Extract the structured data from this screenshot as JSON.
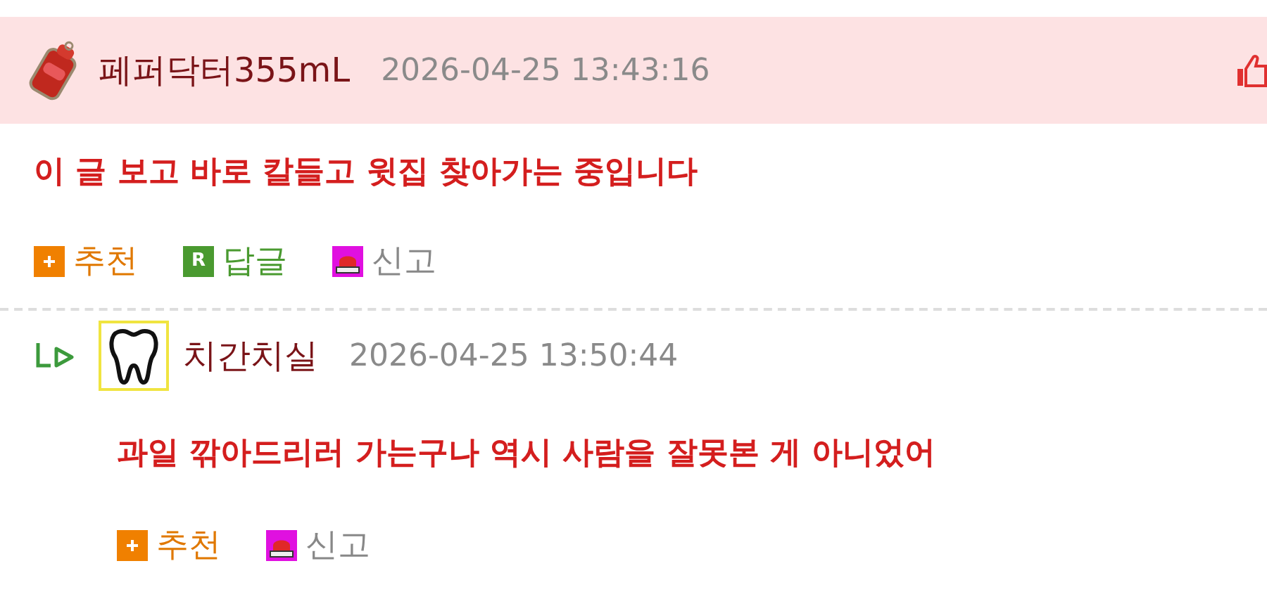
{
  "comments": [
    {
      "kind": "post",
      "author": "페퍼닥터355mL",
      "time": "2026-04-25 13:43:16",
      "text": "이 글 보고 바로 칼들고 윗집 찾아가는 중입니다",
      "actions": [
        {
          "kind": "recommend",
          "label": "추천"
        },
        {
          "kind": "reply",
          "label": "답글",
          "icon_text": "R"
        },
        {
          "kind": "report",
          "label": "신고"
        }
      ]
    },
    {
      "kind": "reply",
      "author": "치간치실",
      "time": "2026-04-25 13:50:44",
      "text": "과일 깎아드리러 가는구나 역시 사람을 잘못본 게 아니었어",
      "actions": [
        {
          "kind": "recommend",
          "label": "추천"
        },
        {
          "kind": "report",
          "label": "신고"
        }
      ]
    }
  ]
}
